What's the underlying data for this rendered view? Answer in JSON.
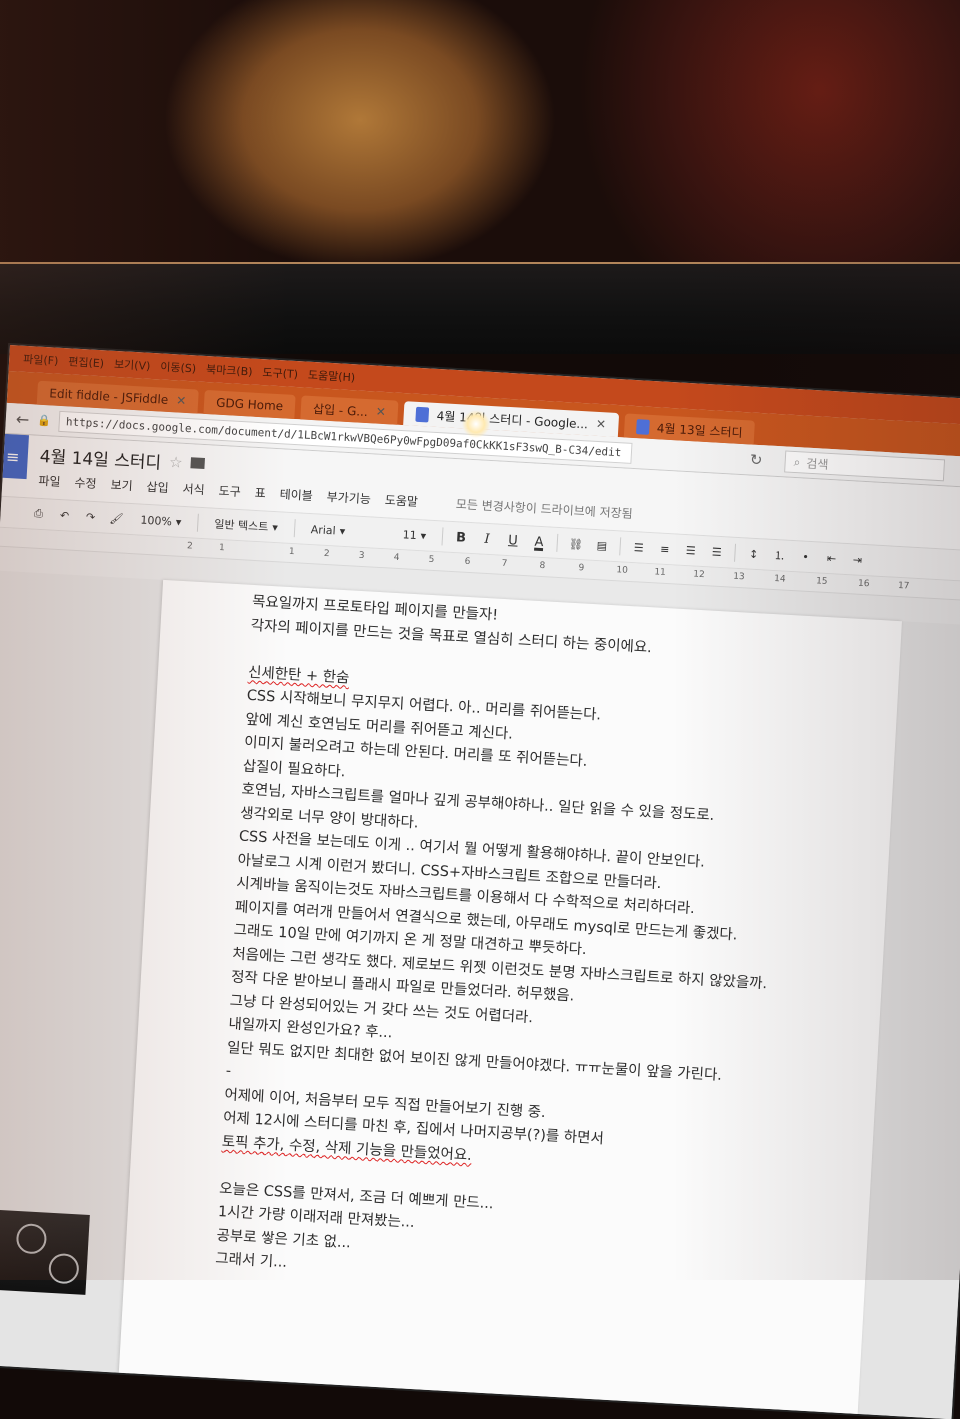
{
  "browser": {
    "menu": [
      "파일(F)",
      "편집(E)",
      "보기(V)",
      "이동(S)",
      "북마크(B)",
      "도구(T)",
      "도움말(H)"
    ],
    "tabs": [
      {
        "label": "Edit fiddle - JSFiddle",
        "active": false
      },
      {
        "label": "GDG Home",
        "active": false
      },
      {
        "label": "삽입 - G...",
        "active": false
      },
      {
        "label": "4월 14일 스터디 - Google...",
        "active": true
      },
      {
        "label": "4월 13일 스터디",
        "active": false
      }
    ],
    "url": "https://docs.google.com/document/d/1LBcW1rkwVBQe6Py0wFpgD09af0CkKK1sF3swQ_B-C34/edit",
    "search_placeholder": "검색"
  },
  "doc": {
    "title": "4월 14일 스터디",
    "menu": [
      "파일",
      "수정",
      "보기",
      "삽입",
      "서식",
      "도구",
      "표",
      "테이블",
      "부가기능",
      "도움말"
    ],
    "saved_message": "모든 변경사항이 드라이브에 저장됨"
  },
  "toolbar": {
    "zoom": "100%",
    "style": "일반 텍스트",
    "font": "Arial",
    "size": "11",
    "bold": "B",
    "italic": "I",
    "underline": "U",
    "text_color": "A"
  },
  "ruler": [
    "2",
    "1",
    "1",
    "2",
    "3",
    "4",
    "5",
    "6",
    "7",
    "8",
    "9",
    "10",
    "11",
    "12",
    "13",
    "14",
    "15",
    "16",
    "17"
  ],
  "body_lines": [
    "목요일까지 프로토타입 페이지를 만들자!",
    "각자의 페이지를 만드는 것을 목표로 열심히 스터디 하는 중이에요.",
    "",
    "신세한탄 + 한숨",
    "CSS 시작해보니 무지무지 어렵다. 아.. 머리를 쥐어뜯는다.",
    "앞에 계신 호연님도 머리를 쥐어뜯고 계신다.",
    "이미지 불러오려고 하는데 안된다. 머리를 또 쥐어뜯는다.",
    "삽질이 필요하다.",
    "호연님, 자바스크립트를 얼마나 깊게 공부해야하나.. 일단 읽을 수 있을 정도로.",
    "생각외로 너무 양이 방대하다.",
    "CSS 사전을 보는데도 이게 .. 여기서 뭘 어떻게 활용해야하나. 끝이 안보인다.",
    "아날로그 시계 이런거 봤더니. CSS+자바스크립트 조합으로 만들더라.",
    "시계바늘 움직이는것도 자바스크립트를 이용해서 다 수학적으로 처리하더라.",
    "페이지를 여러개 만들어서 연결식으로 했는데, 아무래도 mysql로 만드는게 좋겠다.",
    "그래도 10일 만에 여기까지 온 게 정말 대견하고 뿌듯하다.",
    "처음에는 그런 생각도 했다. 제로보드 위젯 이런것도 분명 자바스크립트로 하지 않았을까.",
    "정작 다운 받아보니 플래시 파일로 만들었더라. 허무했음.",
    "그냥 다 완성되어있는 거 갖다 쓰는 것도 어렵더라.",
    "내일까지 완성인가요? 후...",
    "일단 뭐도 없지만 최대한 없어 보이진 않게 만들어야겠다. ㅠㅠ눈물이 앞을 가린다.",
    "-",
    "어제에 이어, 처음부터 모두 직접 만들어보기 진행 중.",
    "어제 12시에 스터디를 마친 후, 집에서 나머지공부(?)를 하면서",
    "토픽 추가, 수정, 삭제 기능을 만들었어요.",
    "",
    "오늘은 CSS를 만져서, 조금 더 예쁘게 만드...",
    "1시간 가량 이래저래 만져봤는...",
    "공부로 쌓은 기초 없...",
    "그래서 기..."
  ]
}
